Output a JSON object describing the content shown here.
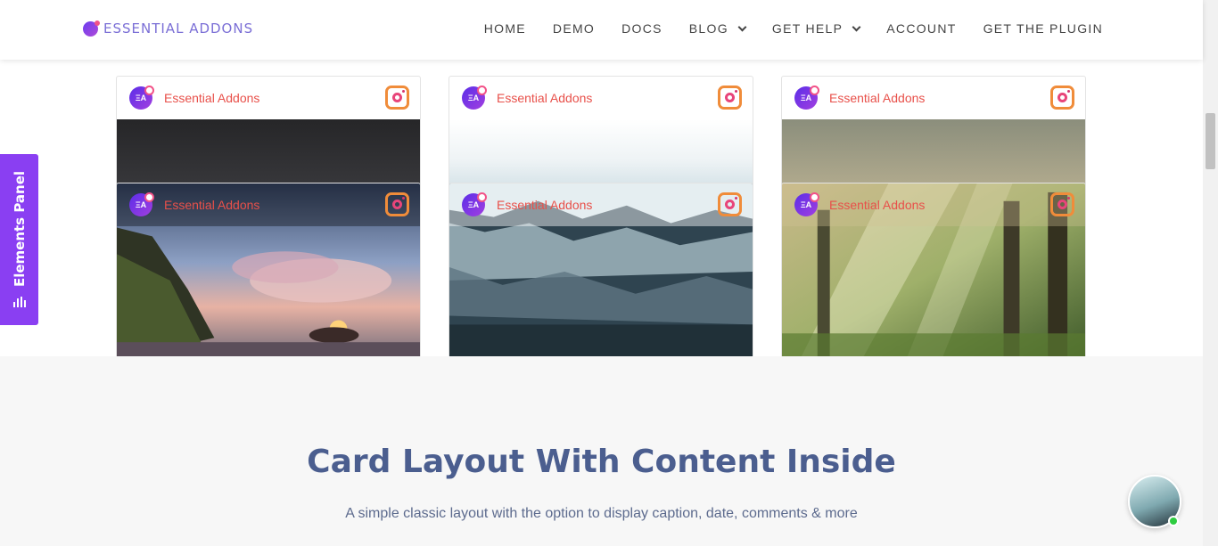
{
  "header": {
    "logo_text": "ESSENTIAL ADDONS",
    "nav": [
      {
        "label": "HOME",
        "dropdown": false
      },
      {
        "label": "DEMO",
        "dropdown": false
      },
      {
        "label": "DOCS",
        "dropdown": false
      },
      {
        "label": "BLOG",
        "dropdown": true
      },
      {
        "label": "GET HELP",
        "dropdown": true
      },
      {
        "label": "ACCOUNT",
        "dropdown": false
      },
      {
        "label": "GET THE PLUGIN",
        "dropdown": false
      }
    ]
  },
  "cards": {
    "account_name": "Essential Addons",
    "avatar_text": "ΞA"
  },
  "section": {
    "title": "Card Layout With Content Inside",
    "subtitle": "A simple classic layout with the  option to display caption, date, comments & more"
  },
  "elements_panel": {
    "label": "Elements Panel"
  },
  "colors": {
    "accent": "#8a3ff2",
    "account_name": "#e8504a",
    "section_title": "#4b5e8f"
  }
}
